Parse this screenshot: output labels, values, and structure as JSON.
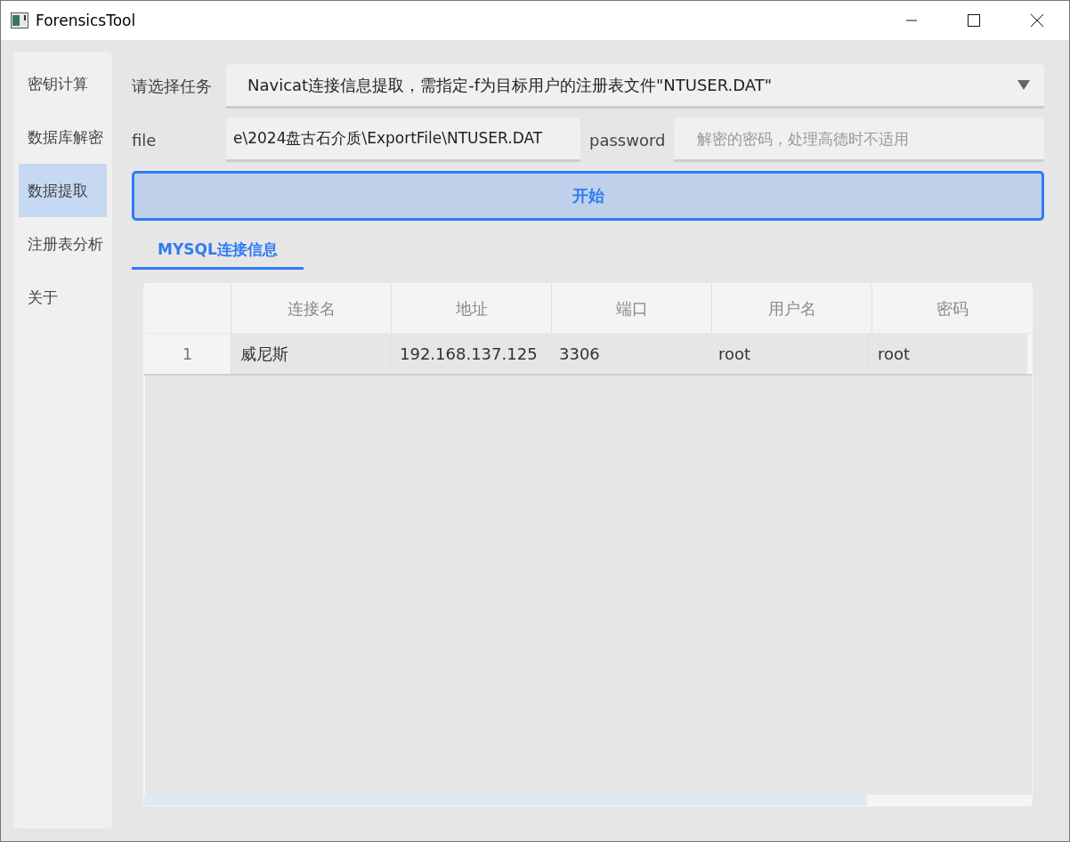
{
  "window": {
    "title": "ForensicsTool"
  },
  "sidebar": {
    "items": [
      {
        "label": "密钥计算",
        "selected": false
      },
      {
        "label": "数据库解密",
        "selected": false
      },
      {
        "label": "数据提取",
        "selected": true
      },
      {
        "label": "注册表分析",
        "selected": false
      },
      {
        "label": "关于",
        "selected": false
      }
    ]
  },
  "task": {
    "label": "请选择任务",
    "value": "Navicat连接信息提取，需指定-f为目标用户的注册表文件\"NTUSER.DAT\""
  },
  "file": {
    "label": "file",
    "value": "e\\2024盘古石介质\\ExportFile\\NTUSER.DAT"
  },
  "password": {
    "label": "password",
    "placeholder": "解密的密码，处理高德时不适用"
  },
  "start_button": "开始",
  "tabs": [
    {
      "label": "MYSQL连接信息",
      "selected": true
    }
  ],
  "table": {
    "columns": [
      "连接名",
      "地址",
      "端口",
      "用户名",
      "密码"
    ],
    "rows": [
      {
        "index": "1",
        "cells": [
          "威尼斯",
          "192.168.137.125",
          "3306",
          "root",
          "root"
        ]
      }
    ]
  }
}
